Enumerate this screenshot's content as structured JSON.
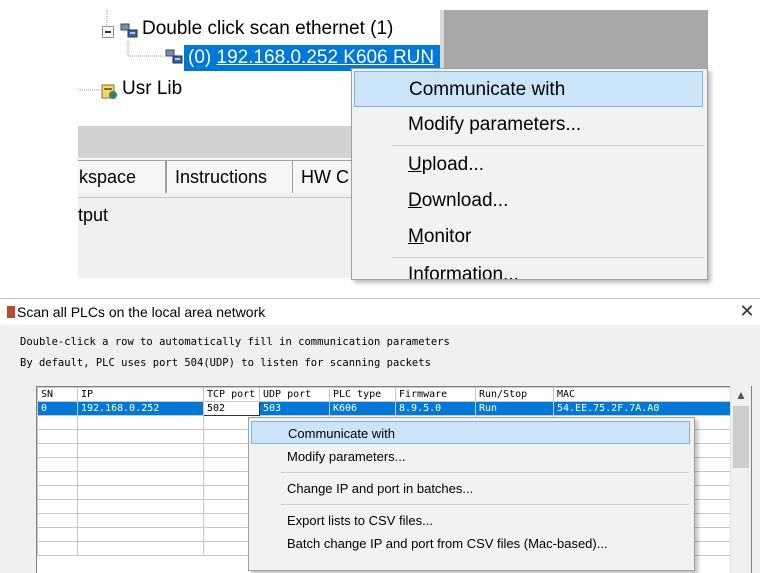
{
  "top_window": {
    "tree": {
      "scan_node_label": "Double click scan ethernet (1)",
      "device_node_label_prefix": "(0)",
      "device_node_label_addr": "192.168.0.252 K606 RUN",
      "usr_lib_label": "Usr Lib"
    },
    "tabs": [
      "kspace",
      "Instructions",
      "HW C"
    ],
    "output_label": "tput",
    "context_menu": [
      {
        "label": "Communicate with",
        "accel": "",
        "rest": ""
      },
      {
        "label": "Modify parameters...",
        "accel": "",
        "rest": ""
      },
      {
        "label": "",
        "accel": "U",
        "rest": "pload..."
      },
      {
        "label": "",
        "accel": "D",
        "rest": "ownload..."
      },
      {
        "label": "",
        "accel": "M",
        "rest": "onitor"
      },
      {
        "label": "Information...",
        "accel": "",
        "rest": ""
      }
    ]
  },
  "scan_dialog": {
    "title": "Scan all PLCs on the local area network",
    "close_glyph": "✕",
    "hint_line1": "Double-click a row to automatically fill in communication parameters",
    "hint_line2": "By default, PLC uses port 504(UDP) to listen for scanning packets",
    "columns": [
      "SN",
      "IP",
      "TCP port",
      "UDP port",
      "PLC type",
      "Firmware",
      "Run/Stop",
      "MAC"
    ],
    "rows": [
      {
        "sn": "0",
        "ip": "192.168.0.252",
        "tcp_port": "502",
        "udp_port": "503",
        "plc_type": "K606",
        "firmware": "8.9.5.0",
        "run_stop": "Run",
        "mac": "54.EE.75.2F.7A.A0"
      }
    ],
    "scroll_up_glyph": "▲",
    "context_menu": [
      "Communicate with",
      "Modify parameters...",
      "Change IP and port in batches...",
      "Export lists to CSV files...",
      "Batch change IP and port from CSV files (Mac-based)..."
    ]
  },
  "colors": {
    "selection_blue": "#0078d7",
    "menu_hover": "#cce4f7",
    "menu_bg": "#f2f2f2"
  }
}
